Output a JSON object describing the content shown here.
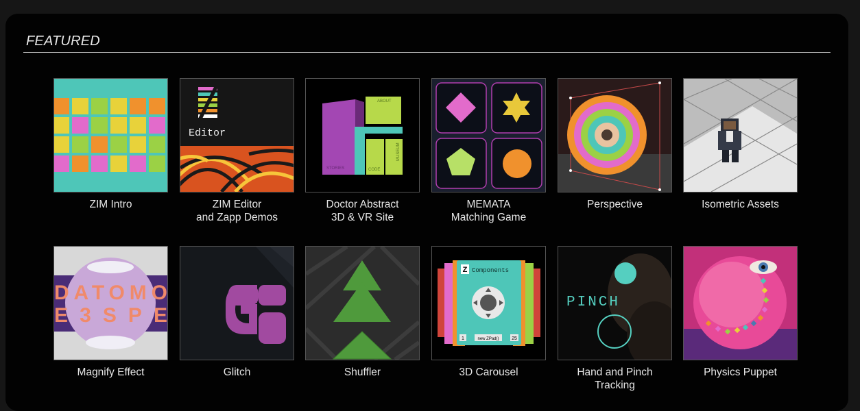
{
  "section": {
    "title": "FEATURED"
  },
  "items": [
    {
      "title": "ZIM Intro"
    },
    {
      "title": "ZIM Editor\nand Zapp Demos",
      "thumb_text": "Editor"
    },
    {
      "title": "Doctor Abstract\n3D & VR Site",
      "thumb_labels": [
        "ABOUT",
        "STORIES",
        "CODE",
        "MUSEUM"
      ]
    },
    {
      "title": "MEMATA\nMatching Game"
    },
    {
      "title": "Perspective"
    },
    {
      "title": "Isometric Assets"
    },
    {
      "title": "Magnify Effect",
      "thumb_text_top": "DATOMO",
      "thumb_text_bottom": "E3SPE"
    },
    {
      "title": "Glitch"
    },
    {
      "title": "Shuffler"
    },
    {
      "title": "3D Carousel",
      "thumb_text": "Components",
      "thumb_small_left": "1",
      "thumb_small_mid": "new ZPad()",
      "thumb_small_right": "25"
    },
    {
      "title": "Hand and Pinch\nTracking",
      "thumb_text": "PINCH"
    },
    {
      "title": "Physics Puppet"
    }
  ],
  "colors": {
    "accent_teal": "#4ec6b8",
    "accent_pink": "#e26bcb",
    "accent_orange": "#f0912d",
    "accent_yellow": "#e8d23a",
    "accent_green": "#9bd145"
  }
}
